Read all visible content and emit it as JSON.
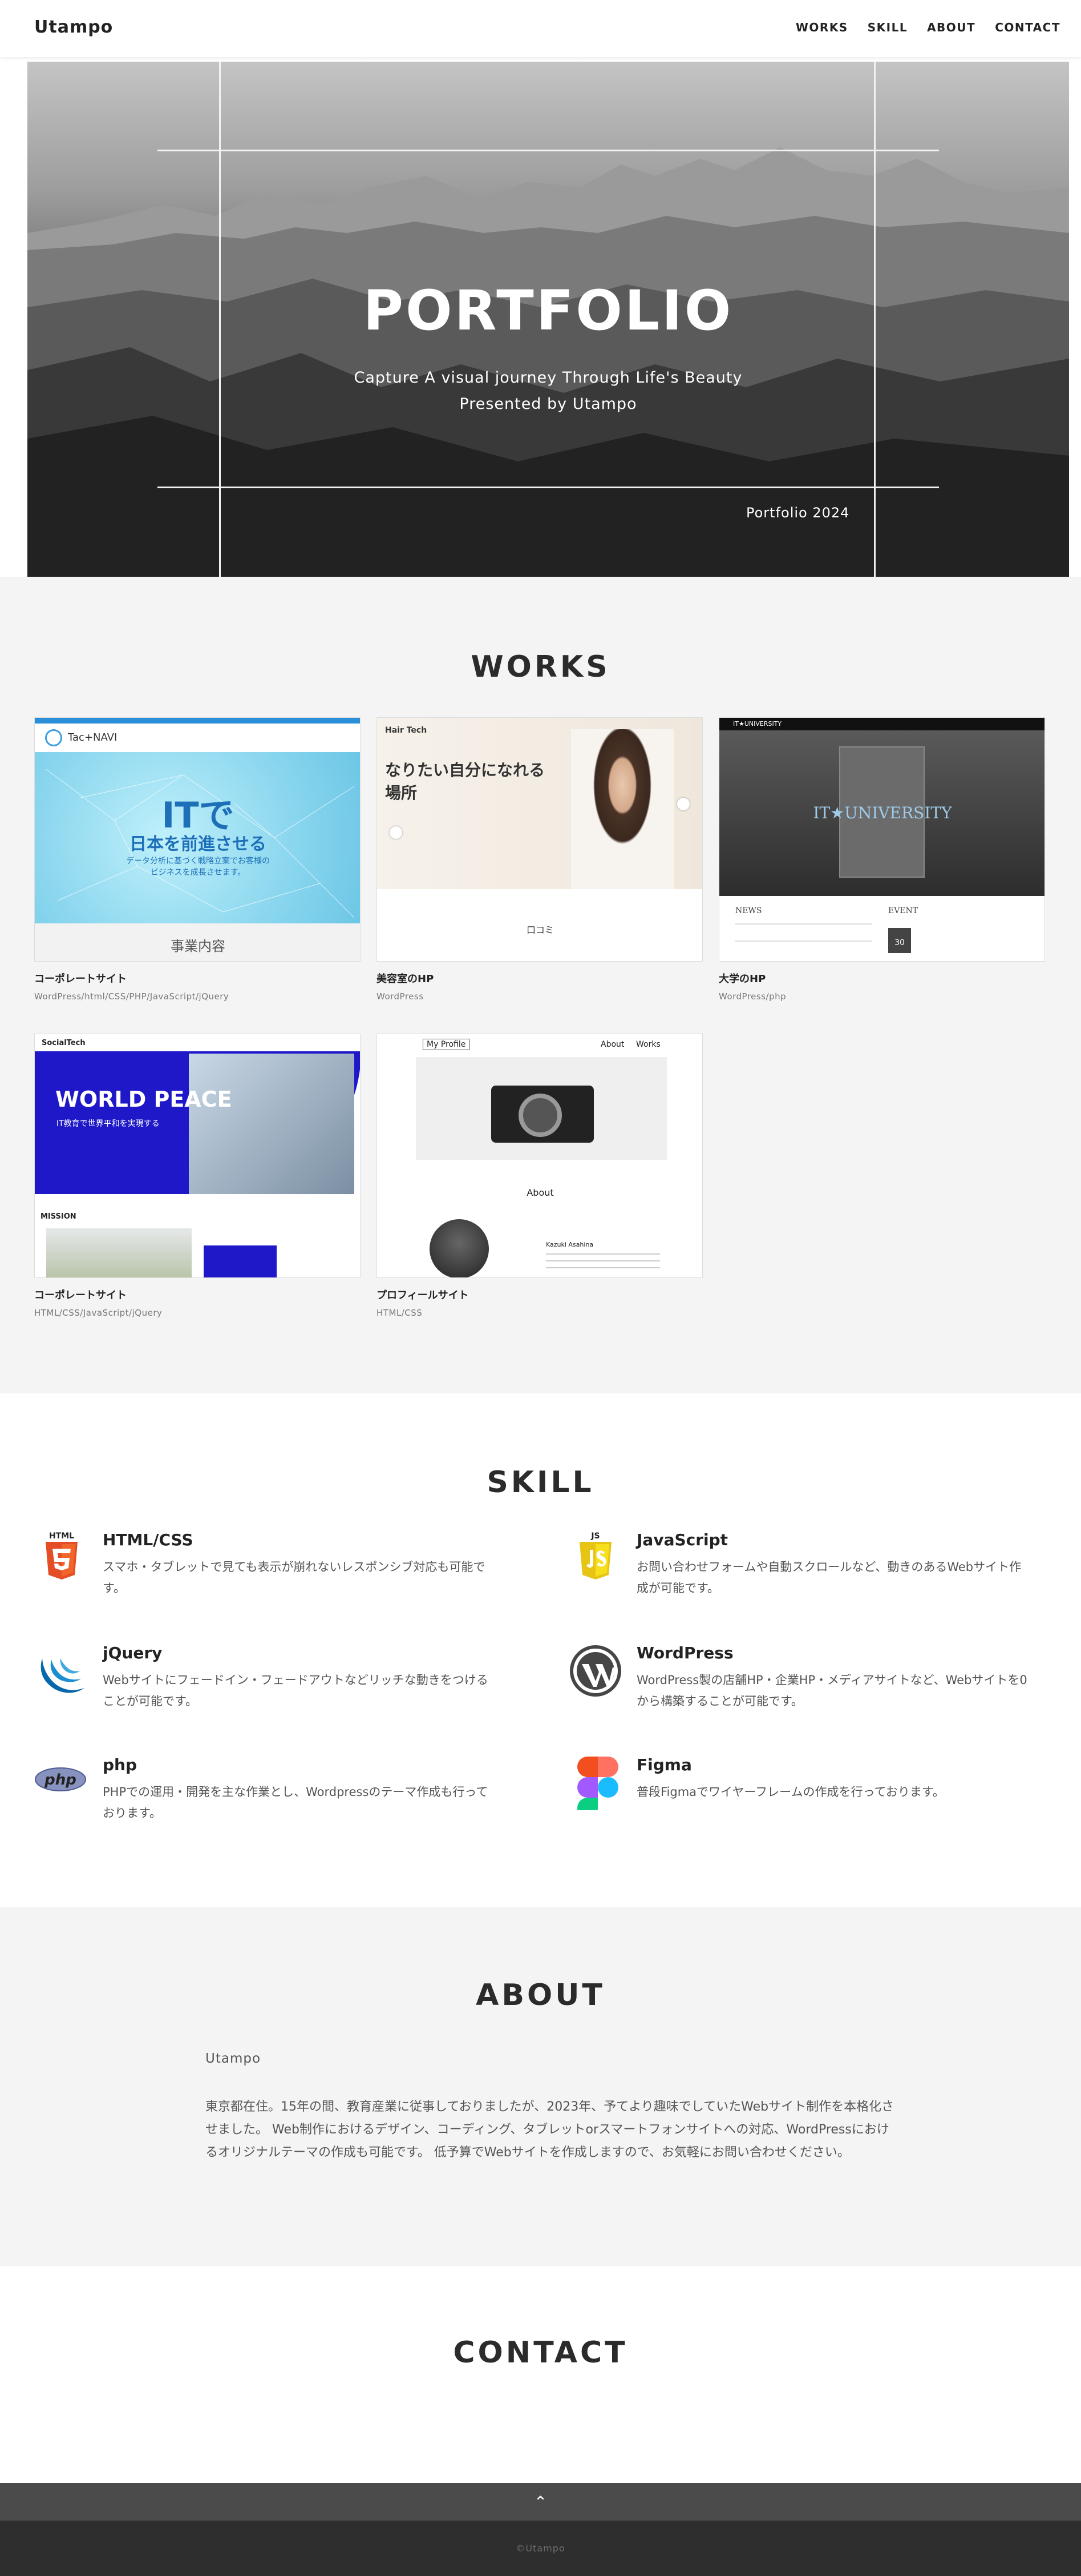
{
  "header": {
    "brand": "Utampo",
    "nav": [
      "WORKS",
      "SKILL",
      "ABOUT",
      "CONTACT"
    ]
  },
  "hero": {
    "title": "PORTFOLIO",
    "subtitle_line1": "Capture A visual journey Through Life's Beauty",
    "subtitle_line2": "Presented by Utampo",
    "year_label": "Portfolio 2024"
  },
  "works": {
    "title": "WORKS",
    "items": [
      {
        "title": "コーポレートサイト",
        "tags": "WordPress/html/CSS/PHP/JavaScript/jQuery",
        "shot": {
          "logo": "Tac+NAVI",
          "headline": "ITで",
          "line2": "日本を前進させる",
          "line3": "データ分析に基づく戦略立案でお客様の",
          "line4": "ビジネスを成長させます。",
          "section": "事業内容"
        }
      },
      {
        "title": "美容室のHP",
        "tags": "WordPress",
        "shot": {
          "logo": "Hair Tech",
          "headline": "なりたい自分になれる",
          "line2": "場所",
          "section": "口コミ"
        }
      },
      {
        "title": "大学のHP",
        "tags": "WordPress/php",
        "shot": {
          "logo": "IT★UNIVERSITY",
          "headline": "IT★UNIVERSITY",
          "news": "NEWS",
          "event": "EVENT",
          "date": "30"
        }
      },
      {
        "title": "コーポレートサイト",
        "tags": "HTML/CSS/JavaScript/jQuery",
        "shot": {
          "logo": "SocialTech",
          "headline": "WORLD PEACE",
          "line2": "IT教育で世界平和を実現する",
          "section": "MISSION"
        }
      },
      {
        "title": "プロフィールサイト",
        "tags": "HTML/CSS",
        "shot": {
          "logo": "My Profile",
          "nav1": "About",
          "nav2": "Works",
          "section": "About",
          "person": "Kazuki Asahina"
        }
      }
    ]
  },
  "skill": {
    "title": "SKILL",
    "items": [
      {
        "name": "HTML/CSS",
        "icon": "html5-icon",
        "desc": "スマホ・タブレットで見ても表示が崩れないレスポンシブ対応も可能です。"
      },
      {
        "name": "JavaScript",
        "icon": "javascript-icon",
        "desc": "お問い合わせフォームや自動スクロールなど、動きのあるWebサイト作成が可能です。"
      },
      {
        "name": "jQuery",
        "icon": "jquery-icon",
        "desc": "Webサイトにフェードイン・フェードアウトなどリッチな動きをつけることが可能です。"
      },
      {
        "name": "WordPress",
        "icon": "wordpress-icon",
        "desc": "WordPress製の店舗HP・企業HP・メディアサイトなど、Webサイトを0から構築することが可能です。"
      },
      {
        "name": "php",
        "icon": "php-icon",
        "desc": "PHPでの運用・開発を主な作業とし、Wordpressのテーマ作成も行っております。"
      },
      {
        "name": "Figma",
        "icon": "figma-icon",
        "desc": "普段Figmaでワイヤーフレームの作成を行っております。"
      }
    ],
    "badges": {
      "html": "HTML",
      "js": "JS",
      "php": "php"
    }
  },
  "about": {
    "title": "ABOUT",
    "name": "Utampo",
    "text": "東京都在住。15年の間、教育産業に従事しておりましたが、2023年、予てより趣味でしていたWebサイト制作を本格化させました。 Web制作におけるデザイン、コーディング、タブレットorスマートフォンサイトへの対応、WordPressにおけるオリジナルテーマの作成も可能です。 低予算でWebサイトを作成しますので、お気軽にお問い合わせください。"
  },
  "contact": {
    "title": "CONTACT"
  },
  "footer": {
    "to_top": "⌃",
    "copyright": "©Utampo"
  },
  "colors": {
    "section_bg": "#f4f4f4",
    "footer_bg": "#2e2e2e",
    "totop_bg": "#4b4b4b",
    "text": "#2b2b2b"
  }
}
